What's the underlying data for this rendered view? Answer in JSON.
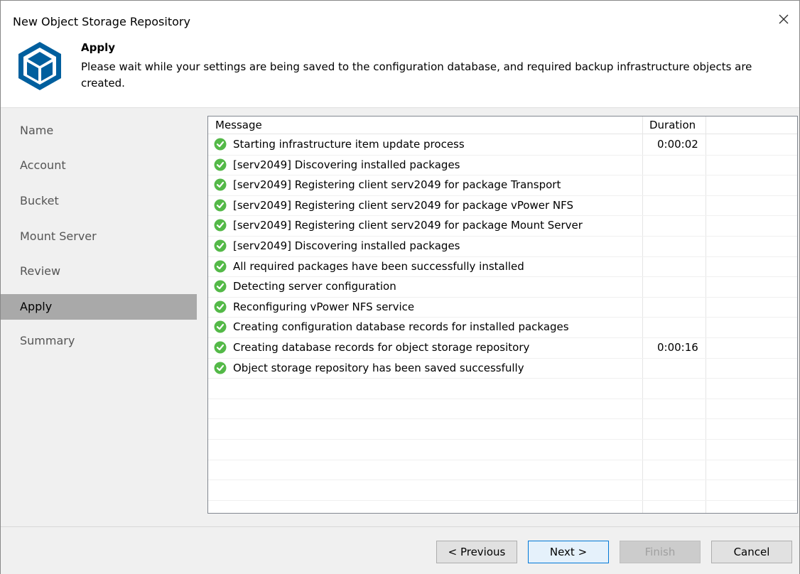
{
  "window": {
    "title": "New Object Storage Repository"
  },
  "header": {
    "title": "Apply",
    "description": "Please wait while your settings are being saved to the configuration database, and required backup infrastructure objects are created."
  },
  "nav": {
    "items": [
      {
        "label": "Name",
        "active": false
      },
      {
        "label": "Account",
        "active": false
      },
      {
        "label": "Bucket",
        "active": false
      },
      {
        "label": "Mount Server",
        "active": false
      },
      {
        "label": "Review",
        "active": false
      },
      {
        "label": "Apply",
        "active": true
      },
      {
        "label": "Summary",
        "active": false
      }
    ]
  },
  "log": {
    "columns": {
      "message": "Message",
      "duration": "Duration"
    },
    "rows": [
      {
        "message": "Starting infrastructure item update process",
        "duration": "0:00:02",
        "status": "success"
      },
      {
        "message": "[serv2049] Discovering installed packages",
        "duration": "",
        "status": "success"
      },
      {
        "message": "[serv2049] Registering client serv2049 for package Transport",
        "duration": "",
        "status": "success"
      },
      {
        "message": "[serv2049] Registering client serv2049 for package vPower NFS",
        "duration": "",
        "status": "success"
      },
      {
        "message": "[serv2049] Registering client serv2049 for package Mount Server",
        "duration": "",
        "status": "success"
      },
      {
        "message": "[serv2049] Discovering installed packages",
        "duration": "",
        "status": "success"
      },
      {
        "message": "All required packages have been successfully installed",
        "duration": "",
        "status": "success"
      },
      {
        "message": "Detecting server configuration",
        "duration": "",
        "status": "success"
      },
      {
        "message": "Reconfiguring vPower NFS service",
        "duration": "",
        "status": "success"
      },
      {
        "message": "Creating configuration database records for installed packages",
        "duration": "",
        "status": "success"
      },
      {
        "message": "Creating database records for object storage repository",
        "duration": "0:00:16",
        "status": "success"
      },
      {
        "message": "Object storage repository has been saved successfully",
        "duration": "",
        "status": "success"
      }
    ]
  },
  "buttons": {
    "previous": "< Previous",
    "next": "Next >",
    "finish": "Finish",
    "cancel": "Cancel"
  },
  "colors": {
    "success": "#54b948",
    "brand": "#005f9e",
    "active_nav": "#a9a9a9"
  }
}
